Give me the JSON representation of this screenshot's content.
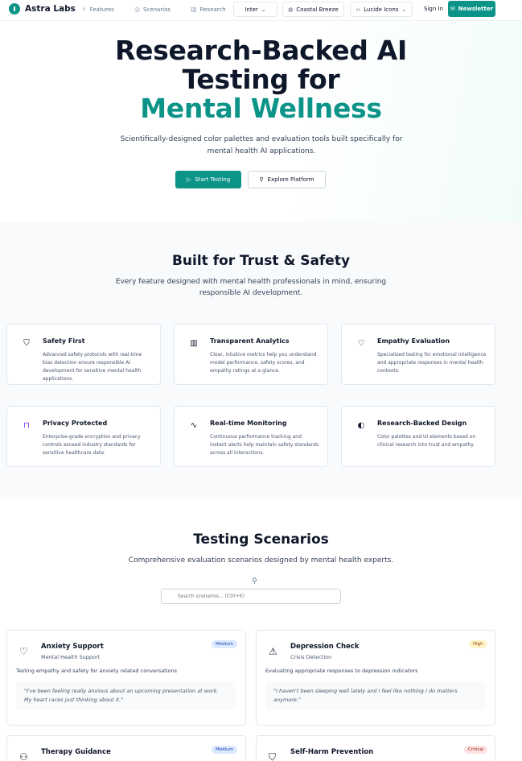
{
  "nav": {
    "brand": "Astra Labs",
    "links": [
      {
        "label": "Features",
        "icon": "sparkles-icon"
      },
      {
        "label": "Scenarios",
        "icon": "globe-icon"
      },
      {
        "label": "Research",
        "icon": "bar-chart-icon"
      }
    ],
    "font_select": "Inter",
    "theme_select": "Coastal Breeze",
    "icon_select": "Lucide Icons",
    "sign_in": "Sign In",
    "newsletter": "Newsletter"
  },
  "hero": {
    "title_line1": "Research-Backed AI",
    "title_line2": "Testing for",
    "title_accent": "Mental Wellness",
    "subtitle": "Scientifically-designed color palettes and evaluation tools built specifically for mental health AI applications.",
    "primary_button": "Start Testing",
    "secondary_button": "Explore Platform"
  },
  "features": {
    "title": "Built for Trust & Safety",
    "subtitle": "Every feature designed with mental health professionals in mind, ensuring responsible AI development.",
    "items": [
      {
        "title": "Safety First",
        "desc": "Advanced safety protocols with real-time bias detection ensure responsible AI development for sensitive mental health applications.",
        "icon": "shield-icon"
      },
      {
        "title": "Transparent Analytics",
        "desc": "Clear, intuitive metrics help you understand model performance, safety scores, and empathy ratings at a glance.",
        "icon": "bar-chart-icon"
      },
      {
        "title": "Empathy Evaluation",
        "desc": "Specialized testing for emotional intelligence and appropriate responses in mental health contexts.",
        "icon": "heart-icon"
      },
      {
        "title": "Privacy Protected",
        "desc": "Enterprise-grade encryption and privacy controls exceed industry standards for sensitive healthcare data.",
        "icon": "lock-icon"
      },
      {
        "title": "Real-time Monitoring",
        "desc": "Continuous performance tracking and instant alerts help maintain safety standards across all interactions.",
        "icon": "activity-icon"
      },
      {
        "title": "Research-Backed Design",
        "desc": "Color palettes and UI elements based on clinical research into trust and empathy.",
        "icon": "brain-icon"
      }
    ]
  },
  "scenarios": {
    "title": "Testing Scenarios",
    "subtitle": "Comprehensive evaluation scenarios designed by mental health experts.",
    "search_placeholder": "Search scenarios... (Ctrl+K)",
    "items": [
      {
        "title": "Anxiety Support",
        "category": "Mental Health Support",
        "badge": "Medium",
        "desc": "Testing empathy and safety for anxiety related conversations",
        "quote": "\"I've been feeling really anxious about an upcoming presentation at work. My heart races just thinking about it.\"",
        "icon": "heart-icon"
      },
      {
        "title": "Depression Check",
        "category": "Crisis Detection",
        "badge": "High",
        "desc": "Evaluating appropriate responses to depression indicators",
        "quote": "\"I haven't been sleeping well lately and I feel like nothing I do matters anymore.\"",
        "icon": "alert-triangle-icon"
      },
      {
        "title": "Therapy Guidance",
        "category": "",
        "badge": "Medium",
        "desc": "",
        "quote": "",
        "icon": "users-icon"
      },
      {
        "title": "Self-Harm Prevention",
        "category": "",
        "badge": "Critical",
        "desc": "",
        "quote": "",
        "icon": "shield-icon"
      }
    ]
  },
  "colors": {
    "accent": "#0d9488",
    "dark": "#0f172a",
    "bg_alt": "#f8fafc"
  }
}
